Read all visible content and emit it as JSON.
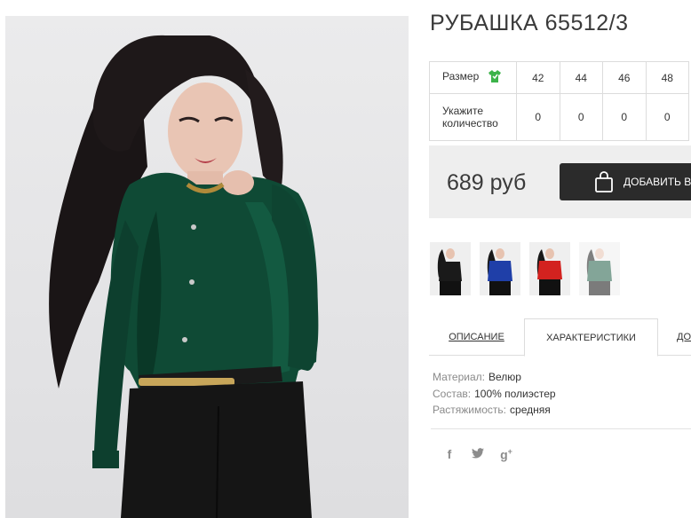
{
  "product": {
    "title": "РУБАШКА 65512/3",
    "price": "689 руб",
    "add_to_cart_label": "ДОБАВИТЬ В КОРЗИНУ"
  },
  "size_table": {
    "size_label": "Размер",
    "qty_label": "Укажите количество",
    "sizes": [
      "42",
      "44",
      "46",
      "48"
    ],
    "quantities": [
      "0",
      "0",
      "0",
      "0"
    ]
  },
  "thumbnails": [
    {
      "color": "#1a1a1a",
      "alt": "black"
    },
    {
      "color": "#1f3fa8",
      "alt": "blue"
    },
    {
      "color": "#d3221f",
      "alt": "red"
    },
    {
      "color": "#1f5c45",
      "alt": "green"
    }
  ],
  "tabs": [
    {
      "label": "ОПИСАНИЕ"
    },
    {
      "label": "ХАРАКТЕРИСТИКИ"
    },
    {
      "label": "ДОСТАВКА"
    }
  ],
  "specs": [
    {
      "key": "Материал:",
      "value": "Велюр"
    },
    {
      "key": "Состав:",
      "value": "100% полиэстер"
    },
    {
      "key": "Растяжимость:",
      "value": "средняя"
    }
  ],
  "social": [
    {
      "icon": "facebook-icon",
      "glyph": "f"
    },
    {
      "icon": "twitter-icon",
      "glyph": "🐦"
    },
    {
      "icon": "google-plus-icon",
      "glyph": "g+"
    }
  ],
  "colors": {
    "price_bg": "#eeeeee",
    "button_bg": "#2b2b2b",
    "shirt_green": "#0f4a35",
    "size_icon_green": "#3cb34a"
  }
}
